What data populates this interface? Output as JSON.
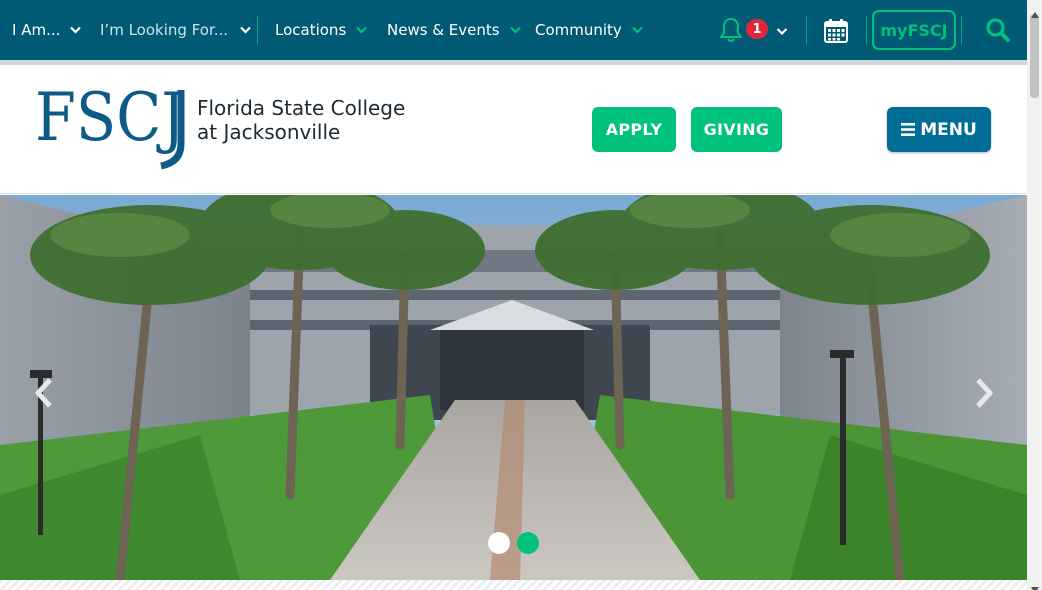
{
  "colors": {
    "topbar_bg": "#005a74",
    "accent_green": "#00c27a",
    "menu_blue": "#006d96",
    "badge_red": "#e0263a",
    "logo_blue": "#0e5a86"
  },
  "topnav": {
    "items": [
      {
        "label": "I Am...",
        "icon": "chevron-down-icon"
      },
      {
        "label": "I’m Looking For...",
        "icon": "chevron-down-icon"
      },
      {
        "label": "Locations",
        "icon": "chevron-down-icon"
      },
      {
        "label": "News & Events",
        "icon": "chevron-down-icon"
      },
      {
        "label": "Community",
        "icon": "chevron-down-icon"
      }
    ],
    "notifications": {
      "icon": "bell-icon",
      "count": "1"
    },
    "calendar_icon": "calendar-icon",
    "myfscj_label": "myFSCJ",
    "search_icon": "search-icon"
  },
  "header": {
    "logo_mark": "FSCJ",
    "logo_line1": "Florida State College",
    "logo_line2": "at Jacksonville",
    "apply_label": "APPLY",
    "giving_label": "GIVING",
    "menu_label": "MENU",
    "menu_icon": "bars-icon"
  },
  "hero": {
    "image": "campus walkway lined with palm trees",
    "prev_icon": "chevron-left-icon",
    "next_icon": "chevron-right-icon",
    "slides": 2,
    "active_slide": 2
  }
}
